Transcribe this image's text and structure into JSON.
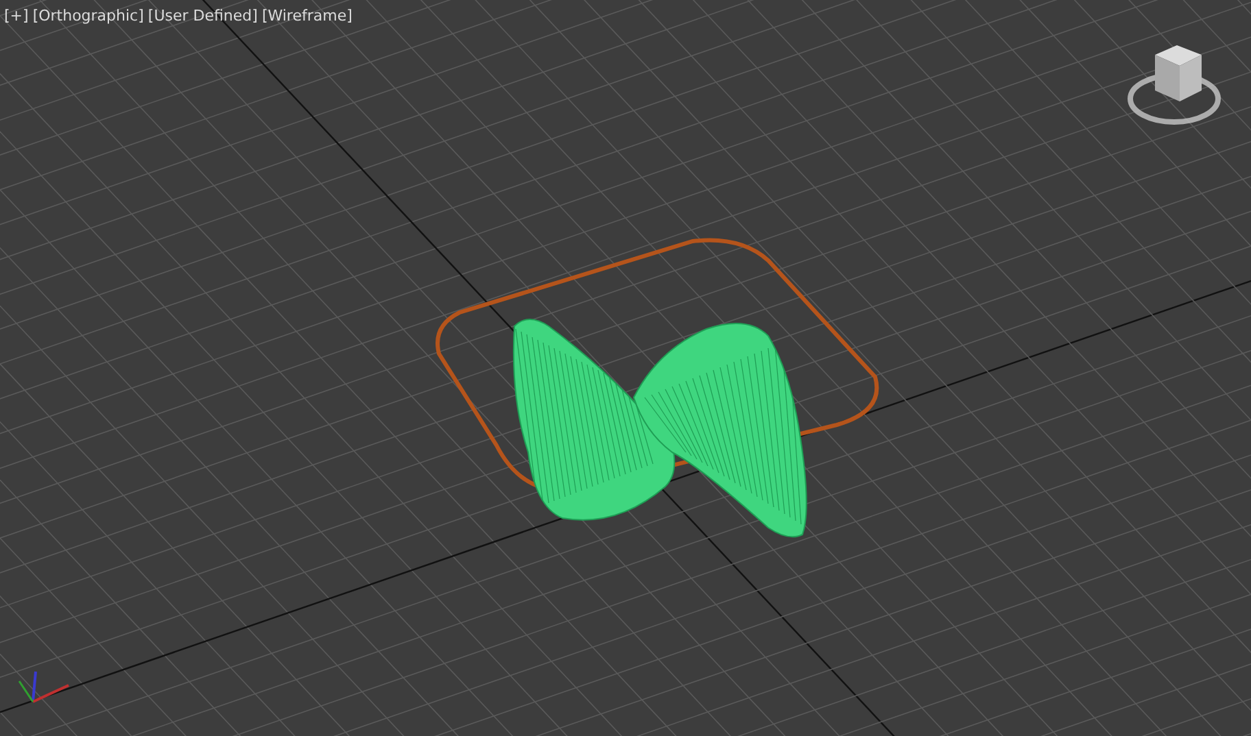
{
  "viewport": {
    "labels": [
      "[+]",
      "[Orthographic]",
      "[User Defined]",
      "[Wireframe]"
    ]
  }
}
